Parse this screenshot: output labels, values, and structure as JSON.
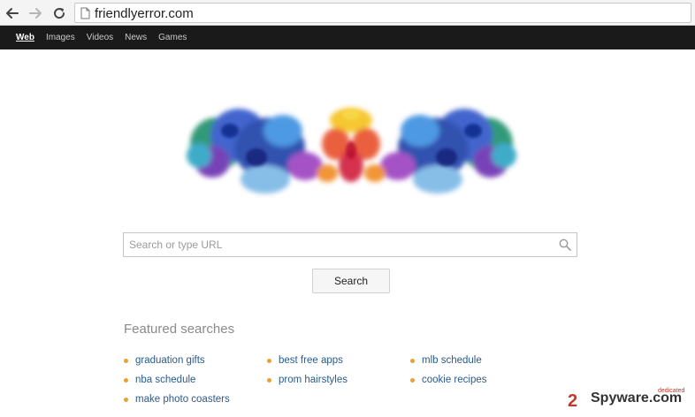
{
  "browser": {
    "url": "friendlyerror.com"
  },
  "topnav": {
    "items": [
      {
        "label": "Web",
        "active": true
      },
      {
        "label": "Images",
        "active": false
      },
      {
        "label": "Videos",
        "active": false
      },
      {
        "label": "News",
        "active": false
      },
      {
        "label": "Games",
        "active": false
      }
    ]
  },
  "search": {
    "placeholder": "Search or type URL",
    "value": "",
    "button_label": "Search"
  },
  "featured": {
    "title": "Featured searches",
    "items": [
      "graduation gifts",
      "best free apps",
      "mlb schedule",
      "nba schedule",
      "prom hairstyles",
      "cookie recipes",
      "make photo coasters"
    ]
  },
  "watermark": {
    "text": "2Spyware.com",
    "tag": "dedicated"
  },
  "colors": {
    "topbar": "#1a1a1a",
    "link": "#2b5a8a",
    "bullet": "#e8a13a"
  },
  "icons": [
    "back-arrow-icon",
    "forward-arrow-icon",
    "reload-icon",
    "page-icon",
    "search-icon",
    "ink-blot-logo"
  ]
}
